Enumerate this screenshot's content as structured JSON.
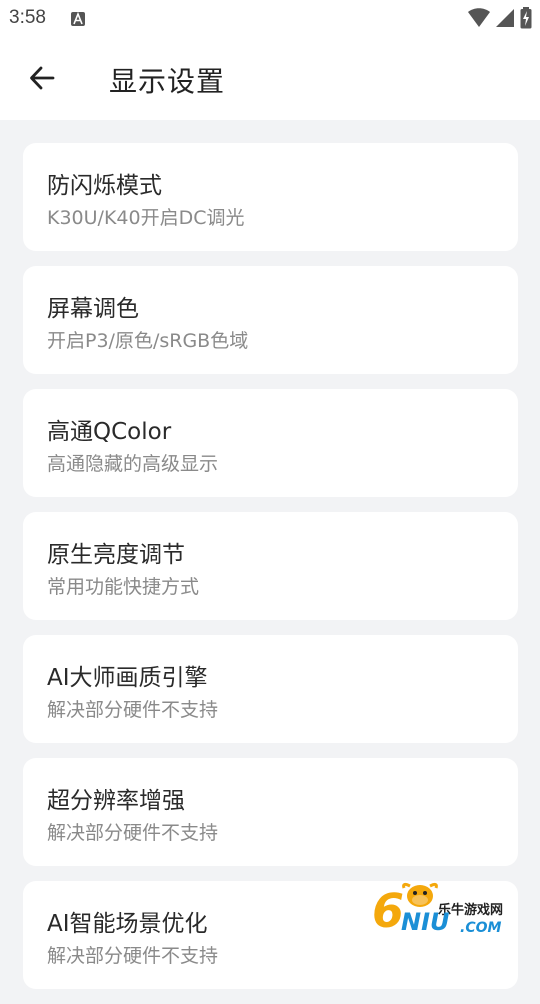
{
  "status_bar": {
    "time": "3:58",
    "notification_icon": "a-notification-icon",
    "icons": [
      "wifi-icon",
      "signal-icon",
      "battery-charging-icon"
    ]
  },
  "app_bar": {
    "back_icon": "arrow-left-icon",
    "title": "显示设置"
  },
  "settings": [
    {
      "title": "防闪烁模式",
      "subtitle": "K30U/K40开启DC调光"
    },
    {
      "title": "屏幕调色",
      "subtitle": "开启P3/原色/sRGB色域"
    },
    {
      "title": "高通QColor",
      "subtitle": "高通隐藏的高级显示"
    },
    {
      "title": "原生亮度调节",
      "subtitle": "常用功能快捷方式"
    },
    {
      "title": "AI大师画质引擎",
      "subtitle": "解决部分硬件不支持"
    },
    {
      "title": "超分辨率增强",
      "subtitle": "解决部分硬件不支持"
    },
    {
      "title": "AI智能场景优化",
      "subtitle": "解决部分硬件不支持"
    }
  ],
  "watermark": {
    "digit": "6",
    "brand_cn": "乐牛游戏网",
    "brand_en": "NIU",
    "domain": ".COM"
  },
  "colors": {
    "background": "#f2f3f5",
    "card": "#ffffff",
    "title_text": "#2a2a2a",
    "subtitle_text": "#8a8a8a",
    "watermark_orange": "#f4a80c",
    "watermark_blue": "#1b8fd6"
  }
}
